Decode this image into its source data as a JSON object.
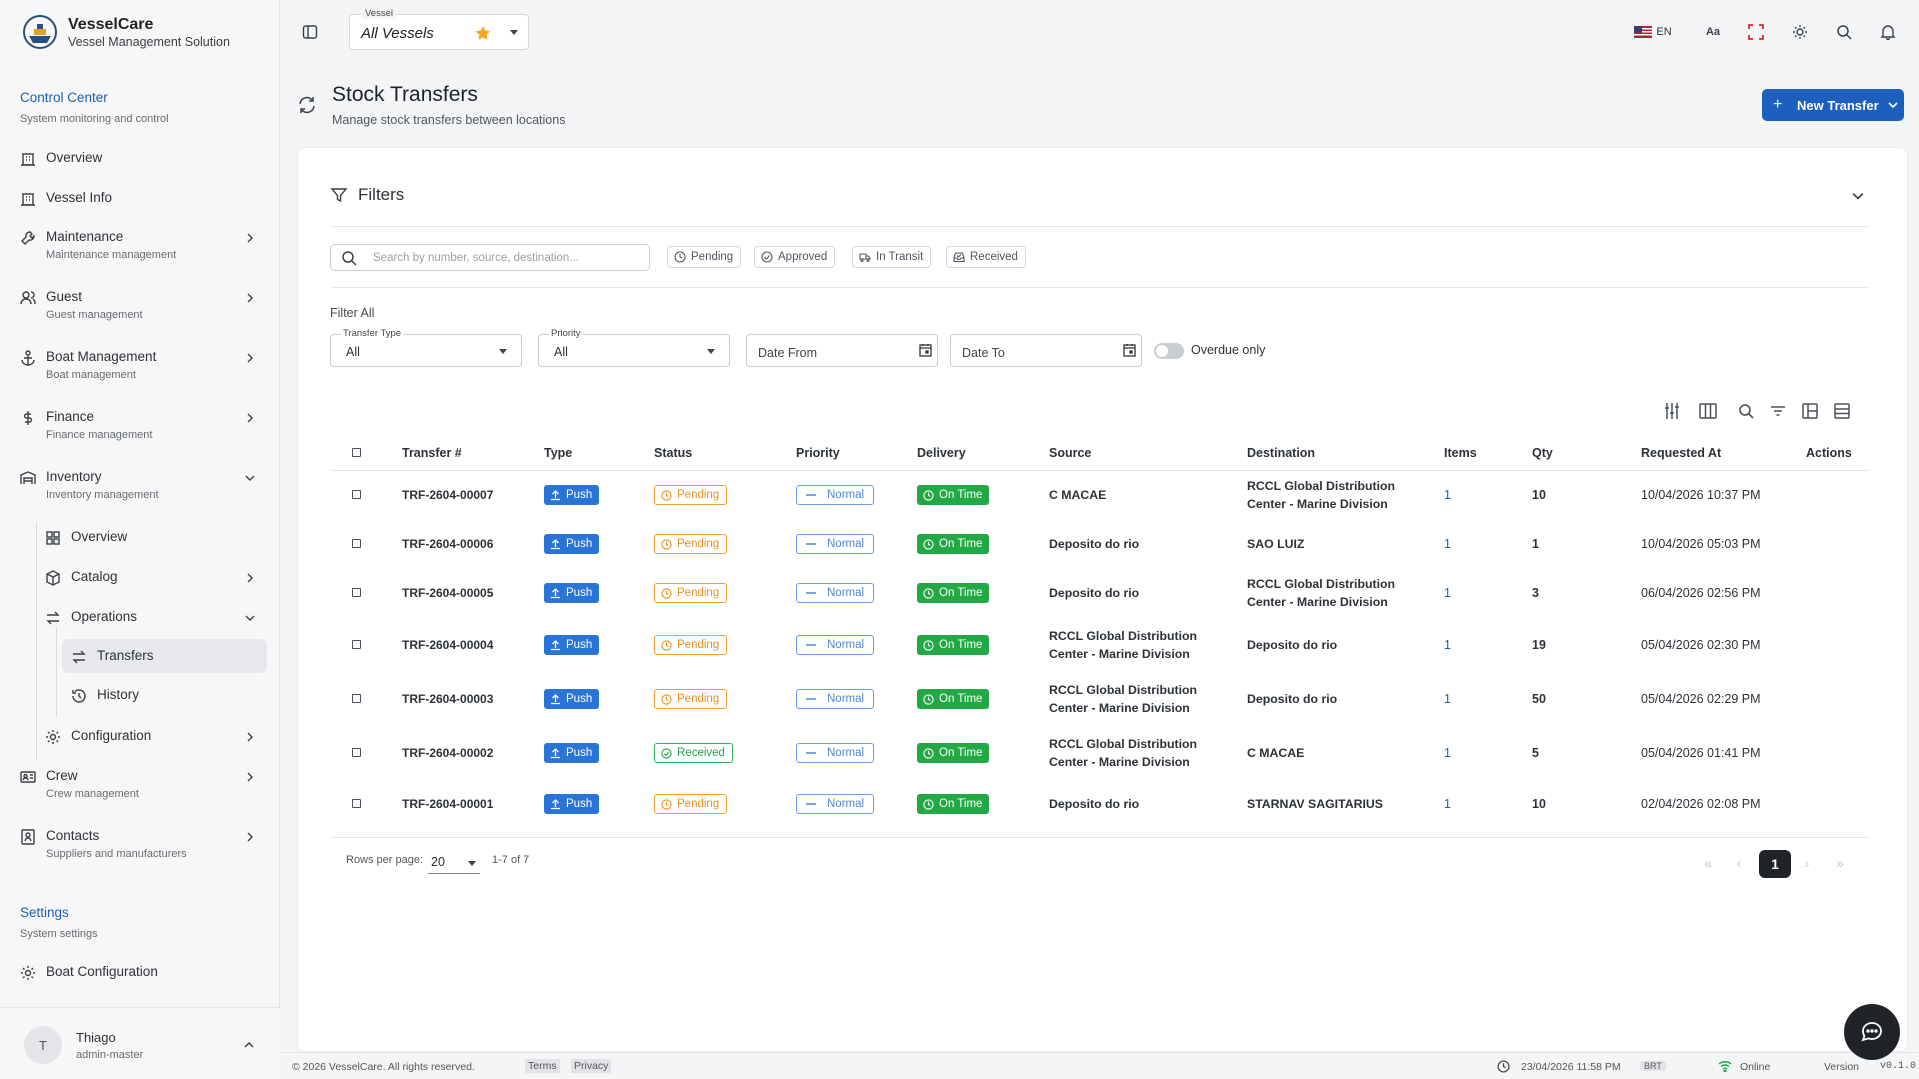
{
  "brand": {
    "title": "VesselCare",
    "subtitle": "Vessel Management Solution"
  },
  "sidebar": {
    "control_center": {
      "title": "Control Center",
      "subtitle": "System monitoring and control"
    },
    "overview": "Overview",
    "vessel_info": "Vessel Info",
    "maintenance": {
      "label": "Maintenance",
      "sub": "Maintenance management"
    },
    "guest": {
      "label": "Guest",
      "sub": "Guest management"
    },
    "boat_management": {
      "label": "Boat Management",
      "sub": "Boat management"
    },
    "finance": {
      "label": "Finance",
      "sub": "Finance management"
    },
    "inventory": {
      "label": "Inventory",
      "sub": "Inventory management"
    },
    "inv_overview": "Overview",
    "catalog": "Catalog",
    "operations": "Operations",
    "transfers": "Transfers",
    "history": "History",
    "configuration": "Configuration",
    "crew": {
      "label": "Crew",
      "sub": "Crew management"
    },
    "contacts": {
      "label": "Contacts",
      "sub": "Suppliers and manufacturers"
    },
    "settings": {
      "title": "Settings",
      "subtitle": "System settings"
    },
    "boat_configuration": "Boat Configuration"
  },
  "user": {
    "initial": "T",
    "name": "Thiago",
    "role": "admin-master"
  },
  "topbar": {
    "vessel_label": "Vessel",
    "vessel_value": "All Vessels",
    "lang": "EN",
    "font_label": "Aa"
  },
  "page": {
    "title": "Stock Transfers",
    "subtitle": "Manage stock transfers between locations",
    "new_button": "New Transfer"
  },
  "filters": {
    "title": "Filters",
    "search_placeholder": "Search by number, source, destination...",
    "chips": [
      "Pending",
      "Approved",
      "In Transit",
      "Received"
    ],
    "filter_all": "Filter All",
    "transfer_type": {
      "label": "Transfer Type",
      "value": "All"
    },
    "priority": {
      "label": "Priority",
      "value": "All"
    },
    "date_from": "Date From",
    "date_to": "Date To",
    "overdue_label": "Overdue only"
  },
  "table": {
    "headers": [
      "Transfer #",
      "Type",
      "Status",
      "Priority",
      "Delivery",
      "Source",
      "Destination",
      "Items",
      "Qty",
      "Requested At",
      "Actions"
    ],
    "rows": [
      {
        "id": "TRF-2604-00007",
        "type": "Push",
        "status": "Pending",
        "priority": "Normal",
        "delivery": "On Time",
        "source": "C MACAE",
        "destination": "RCCL Global Distribution Center - Marine Division",
        "items": "1",
        "qty": "10",
        "requested": "10/04/2026 10:37 PM"
      },
      {
        "id": "TRF-2604-00006",
        "type": "Push",
        "status": "Pending",
        "priority": "Normal",
        "delivery": "On Time",
        "source": "Deposito do rio",
        "destination": "SAO LUIZ",
        "items": "1",
        "qty": "1",
        "requested": "10/04/2026 05:03 PM"
      },
      {
        "id": "TRF-2604-00005",
        "type": "Push",
        "status": "Pending",
        "priority": "Normal",
        "delivery": "On Time",
        "source": "Deposito do rio",
        "destination": "RCCL Global Distribution Center - Marine Division",
        "items": "1",
        "qty": "3",
        "requested": "06/04/2026 02:56 PM"
      },
      {
        "id": "TRF-2604-00004",
        "type": "Push",
        "status": "Pending",
        "priority": "Normal",
        "delivery": "On Time",
        "source": "RCCL Global Distribution Center - Marine Division",
        "destination": "Deposito do rio",
        "items": "1",
        "qty": "19",
        "requested": "05/04/2026 02:30 PM"
      },
      {
        "id": "TRF-2604-00003",
        "type": "Push",
        "status": "Pending",
        "priority": "Normal",
        "delivery": "On Time",
        "source": "RCCL Global Distribution Center - Marine Division",
        "destination": "Deposito do rio",
        "items": "1",
        "qty": "50",
        "requested": "05/04/2026 02:29 PM"
      },
      {
        "id": "TRF-2604-00002",
        "type": "Push",
        "status": "Received",
        "priority": "Normal",
        "delivery": "On Time",
        "source": "RCCL Global Distribution Center - Marine Division",
        "destination": "C MACAE",
        "items": "1",
        "qty": "5",
        "requested": "05/04/2026 01:41 PM"
      },
      {
        "id": "TRF-2604-00001",
        "type": "Push",
        "status": "Pending",
        "priority": "Normal",
        "delivery": "On Time",
        "source": "Deposito do rio",
        "destination": "STARNAV SAGITARIUS",
        "items": "1",
        "qty": "10",
        "requested": "02/04/2026 02:08 PM"
      }
    ]
  },
  "pagination": {
    "rows_label": "Rows per page:",
    "rows_value": "20",
    "range": "1-7 of 7",
    "current": "1"
  },
  "footer": {
    "copyright": "© 2026 VesselCare. All rights reserved.",
    "terms": "Terms",
    "privacy": "Privacy",
    "datetime": "23/04/2026 11:58 PM",
    "tz": "BRT",
    "status": "Online",
    "version_label": "Version",
    "version": "v0.1.0"
  },
  "colors": {
    "primary": "#1c5fbd",
    "pending": "#e89020",
    "received": "#26a14e",
    "on_time": "#22a844",
    "push": "#2a74d6"
  }
}
